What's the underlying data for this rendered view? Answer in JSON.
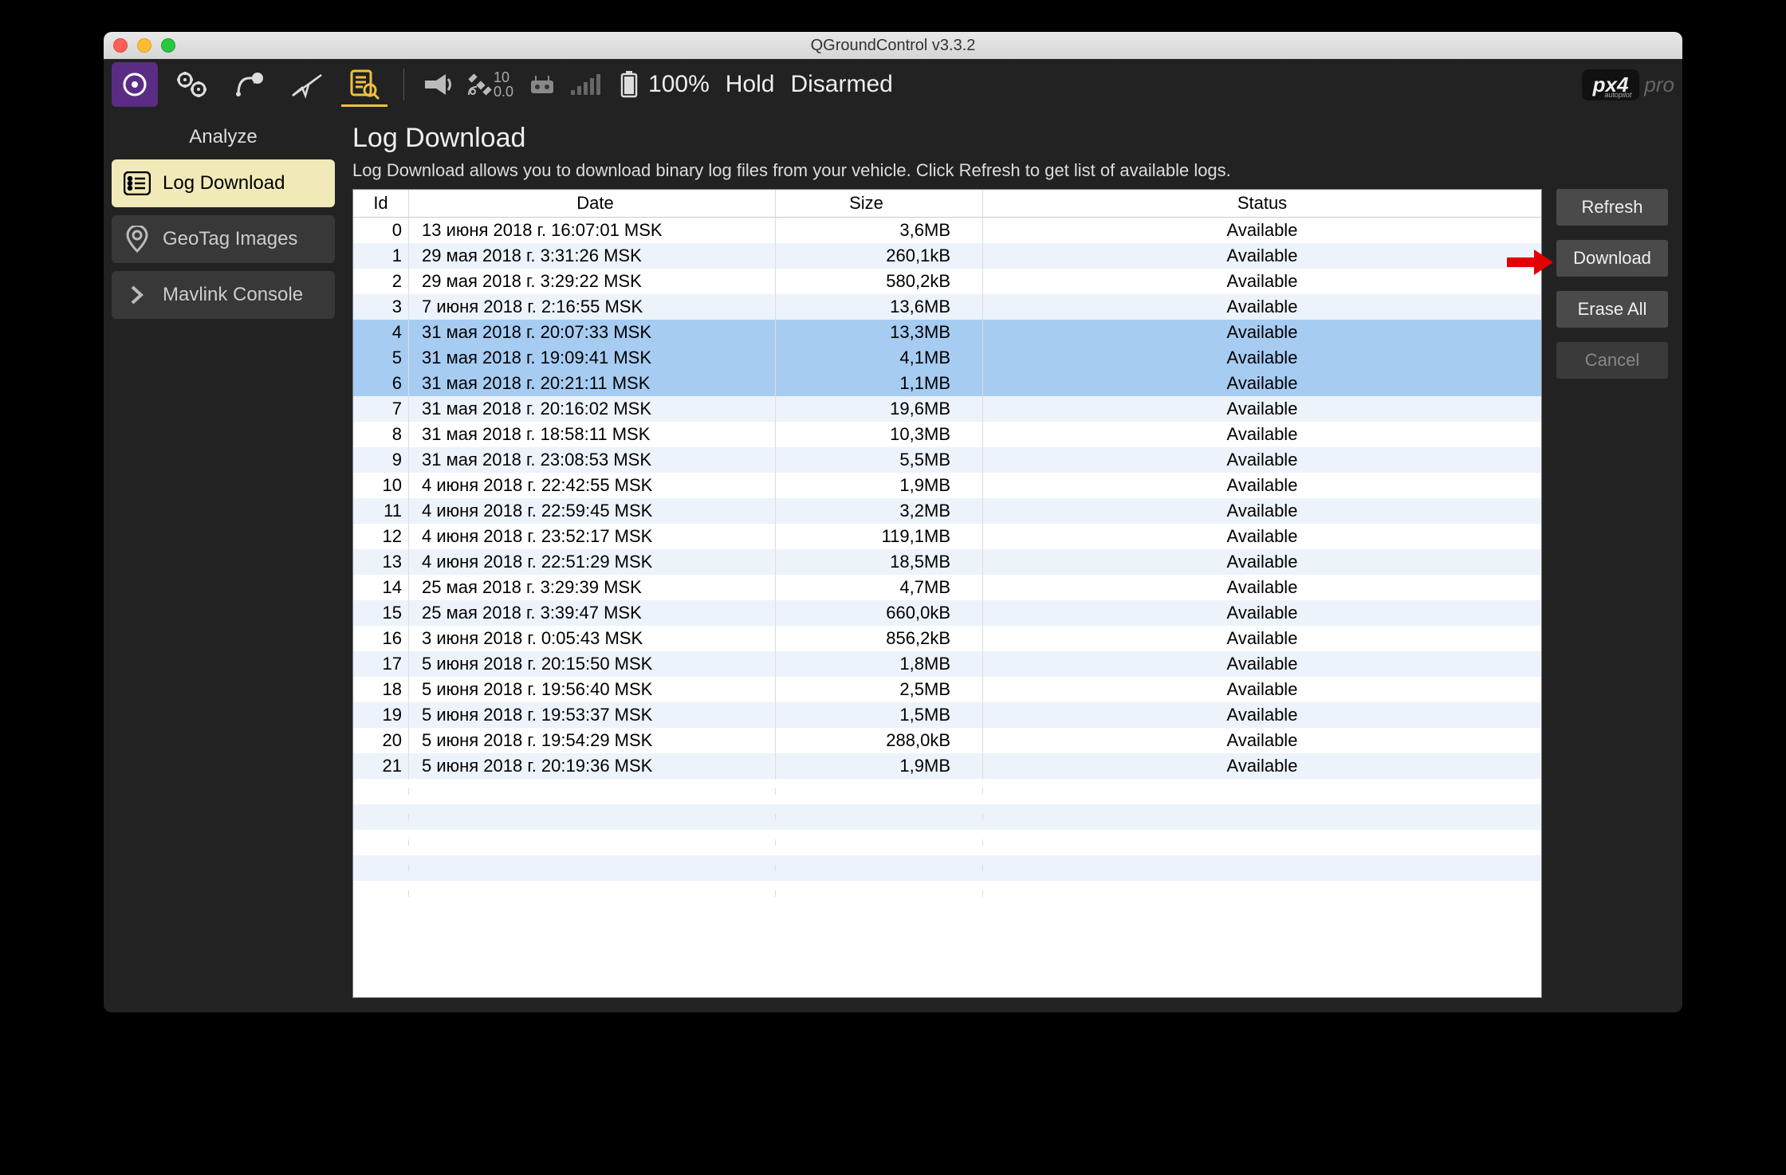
{
  "window": {
    "title": "QGroundControl v3.3.2"
  },
  "toolbar": {
    "stat_top": "10",
    "stat_bottom": "0.0",
    "battery": "100%",
    "mode": "Hold",
    "armed": "Disarmed",
    "logo_main": "px4",
    "logo_sub": "autopilot",
    "logo_suffix": "pro"
  },
  "sidebar": {
    "title": "Analyze",
    "items": [
      {
        "label": "Log Download"
      },
      {
        "label": "GeoTag Images"
      },
      {
        "label": "Mavlink Console"
      }
    ]
  },
  "page": {
    "title": "Log Download",
    "description": "Log Download allows you to download binary log files from your vehicle. Click Refresh to get list of available logs."
  },
  "table": {
    "headers": {
      "id": "Id",
      "date": "Date",
      "size": "Size",
      "status": "Status"
    },
    "rows": [
      {
        "id": "0",
        "date": "13 июня 2018 г. 16:07:01 MSK",
        "size": "3,6MB",
        "status": "Available",
        "selected": false
      },
      {
        "id": "1",
        "date": "29 мая 2018 г. 3:31:26 MSK",
        "size": "260,1kB",
        "status": "Available",
        "selected": false
      },
      {
        "id": "2",
        "date": "29 мая 2018 г. 3:29:22 MSK",
        "size": "580,2kB",
        "status": "Available",
        "selected": false
      },
      {
        "id": "3",
        "date": "7 июня 2018 г. 2:16:55 MSK",
        "size": "13,6MB",
        "status": "Available",
        "selected": false
      },
      {
        "id": "4",
        "date": "31 мая 2018 г. 20:07:33 MSK",
        "size": "13,3MB",
        "status": "Available",
        "selected": true
      },
      {
        "id": "5",
        "date": "31 мая 2018 г. 19:09:41 MSK",
        "size": "4,1MB",
        "status": "Available",
        "selected": true
      },
      {
        "id": "6",
        "date": "31 мая 2018 г. 20:21:11 MSK",
        "size": "1,1MB",
        "status": "Available",
        "selected": true
      },
      {
        "id": "7",
        "date": "31 мая 2018 г. 20:16:02 MSK",
        "size": "19,6MB",
        "status": "Available",
        "selected": false
      },
      {
        "id": "8",
        "date": "31 мая 2018 г. 18:58:11 MSK",
        "size": "10,3MB",
        "status": "Available",
        "selected": false
      },
      {
        "id": "9",
        "date": "31 мая 2018 г. 23:08:53 MSK",
        "size": "5,5MB",
        "status": "Available",
        "selected": false
      },
      {
        "id": "10",
        "date": "4 июня 2018 г. 22:42:55 MSK",
        "size": "1,9MB",
        "status": "Available",
        "selected": false
      },
      {
        "id": "11",
        "date": "4 июня 2018 г. 22:59:45 MSK",
        "size": "3,2MB",
        "status": "Available",
        "selected": false
      },
      {
        "id": "12",
        "date": "4 июня 2018 г. 23:52:17 MSK",
        "size": "119,1MB",
        "status": "Available",
        "selected": false
      },
      {
        "id": "13",
        "date": "4 июня 2018 г. 22:51:29 MSK",
        "size": "18,5MB",
        "status": "Available",
        "selected": false
      },
      {
        "id": "14",
        "date": "25 мая 2018 г. 3:29:39 MSK",
        "size": "4,7MB",
        "status": "Available",
        "selected": false
      },
      {
        "id": "15",
        "date": "25 мая 2018 г. 3:39:47 MSK",
        "size": "660,0kB",
        "status": "Available",
        "selected": false
      },
      {
        "id": "16",
        "date": "3 июня 2018 г. 0:05:43 MSK",
        "size": "856,2kB",
        "status": "Available",
        "selected": false
      },
      {
        "id": "17",
        "date": "5 июня 2018 г. 20:15:50 MSK",
        "size": "1,8MB",
        "status": "Available",
        "selected": false
      },
      {
        "id": "18",
        "date": "5 июня 2018 г. 19:56:40 MSK",
        "size": "2,5MB",
        "status": "Available",
        "selected": false
      },
      {
        "id": "19",
        "date": "5 июня 2018 г. 19:53:37 MSK",
        "size": "1,5MB",
        "status": "Available",
        "selected": false
      },
      {
        "id": "20",
        "date": "5 июня 2018 г. 19:54:29 MSK",
        "size": "288,0kB",
        "status": "Available",
        "selected": false
      },
      {
        "id": "21",
        "date": "5 июня 2018 г. 20:19:36 MSK",
        "size": "1,9MB",
        "status": "Available",
        "selected": false
      }
    ]
  },
  "actions": {
    "refresh": "Refresh",
    "download": "Download",
    "erase_all": "Erase All",
    "cancel": "Cancel"
  }
}
